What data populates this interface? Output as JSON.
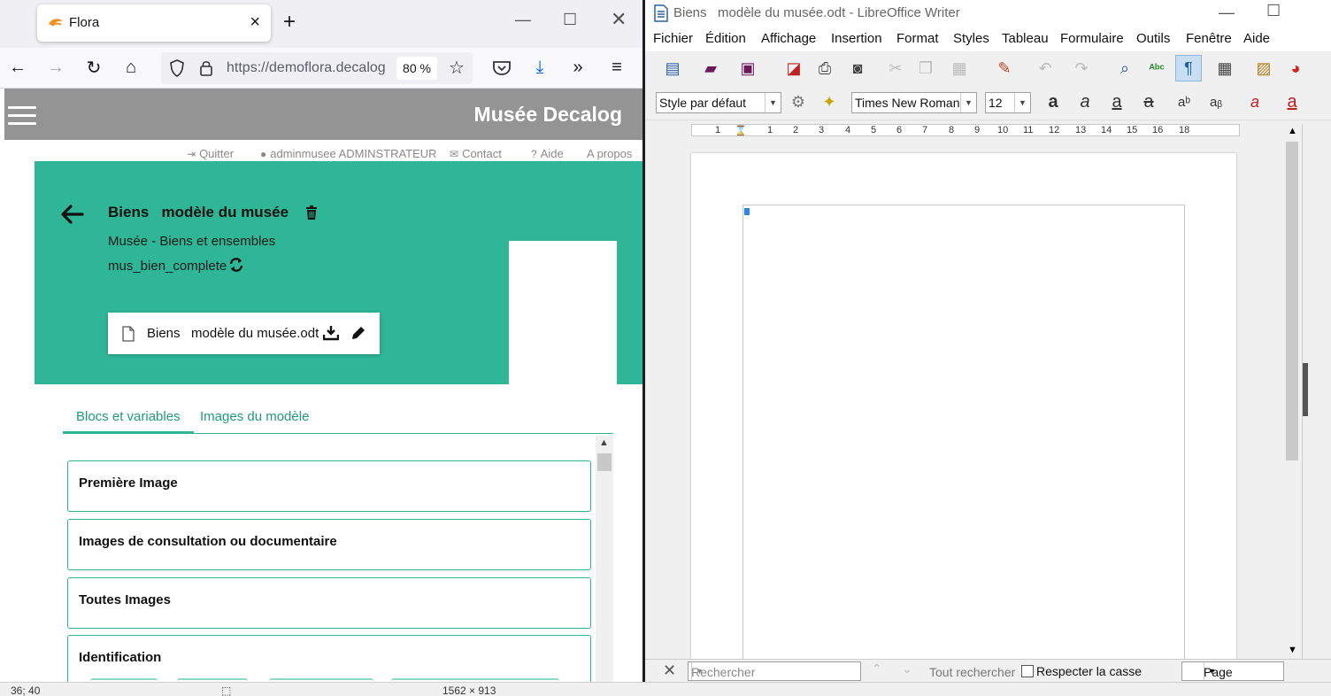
{
  "firefox": {
    "tab_title": "Flora",
    "url": "https://demoflora.decalog",
    "zoom": "80 %"
  },
  "page": {
    "brand": "Musée Decalog",
    "links": {
      "quit": "Quitter",
      "user": "adminmusee ADMINSTRATEUR",
      "contact": "Contact",
      "help": "Aide",
      "about": "A propos"
    },
    "title": "Biens   modèle du musée",
    "subtitle": "Musée - Biens et ensembles",
    "code": "mus_bien_complete",
    "file_name": "Biens   modèle du musée.odt",
    "tabs": [
      "Blocs et variables",
      "Images du modèle"
    ],
    "blocks": [
      "Première Image",
      "Images de consultation ou documentaire",
      "Toutes Images",
      "Identification"
    ]
  },
  "writer": {
    "title": "Biens   modèle du musée.odt - LibreOffice Writer",
    "menu": [
      "Fichier",
      "Édition",
      "Affichage",
      "Insertion",
      "Format",
      "Styles",
      "Tableau",
      "Formulaire",
      "Outils",
      "Fenêtre",
      "Aide"
    ],
    "paragraph_style": "Style par défaut",
    "font_name": "Times New Roman",
    "font_size": "12",
    "ruler_numbers": [
      "1",
      "1",
      "1",
      "2",
      "3",
      "4",
      "5",
      "6",
      "7",
      "8",
      "9",
      "10",
      "11",
      "12",
      "13",
      "14",
      "15",
      "16",
      "17",
      "18"
    ],
    "find_placeholder": "Rechercher",
    "find_all": "Tout rechercher",
    "match_case": "Respecter la casse",
    "find_mode": "Page"
  },
  "status_bar": {
    "left": "36; 40",
    "right": "1562 × 913"
  }
}
